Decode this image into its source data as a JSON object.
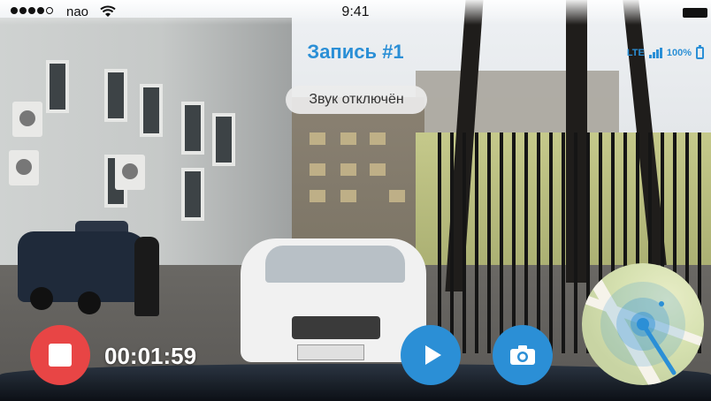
{
  "status_bar": {
    "carrier": "nao",
    "time": "9:41",
    "signal_dots_filled": 4,
    "signal_dots_total": 5
  },
  "recording": {
    "title": "Запись #1",
    "elapsed": "00:01:59",
    "toast": "Звук отключён"
  },
  "device_status": {
    "network": "LTE",
    "battery": "100%"
  },
  "icons": {
    "stop": "stop-icon",
    "play": "play-icon",
    "camera": "camera-icon",
    "map": "map-icon",
    "wifi": "wifi-icon",
    "battery": "battery-icon"
  },
  "colors": {
    "accent": "#2b8fd6",
    "stop": "#e84545"
  }
}
